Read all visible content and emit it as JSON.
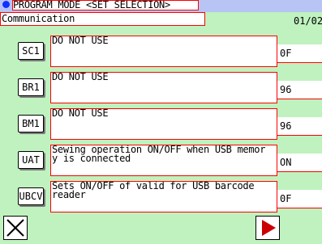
{
  "title_bar": {
    "title": "PROGRAM MODE <SET SELECTION>"
  },
  "header": {
    "category_label": "Communication",
    "page_indicator": "01/02"
  },
  "parameters": [
    {
      "code": "SC1",
      "description": "DO NOT USE",
      "value": "0F"
    },
    {
      "code": "BR1",
      "description": "DO NOT USE",
      "value": "96"
    },
    {
      "code": "BM1",
      "description": "DO NOT USE",
      "value": "96"
    },
    {
      "code": "UAT",
      "description": "Sewing operation ON/OFF when USB memor\ny is connected",
      "value": "ON"
    },
    {
      "code": "UBCV",
      "description": "Sets ON/OFF of valid for USB barcode\n  reader",
      "value": "0F"
    }
  ],
  "footer": {
    "close_icon": "close-x-icon",
    "next_icon": "next-page-arrow-icon"
  },
  "colors": {
    "title_bar_bg": "#b8c4f4",
    "panel_bg": "#bff2bf",
    "field_border": "#ff0000",
    "status_dot": "#1030ff",
    "arrow": "#cc0000"
  }
}
